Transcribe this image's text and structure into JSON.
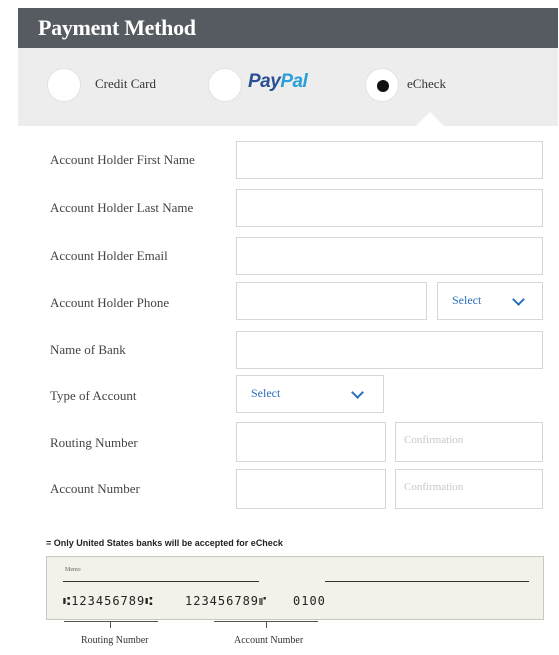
{
  "header": {
    "title": "Payment Method"
  },
  "payment_options": [
    {
      "label": "Credit Card",
      "selected": false
    },
    {
      "label_parts": [
        "Pay",
        "Pal"
      ],
      "selected": false
    },
    {
      "label": "eCheck",
      "selected": true
    }
  ],
  "form": {
    "first_name": {
      "label": "Account Holder First Name",
      "value": ""
    },
    "last_name": {
      "label": "Account Holder Last Name",
      "value": ""
    },
    "email": {
      "label": "Account Holder Email",
      "value": ""
    },
    "phone": {
      "label": "Account Holder Phone",
      "value": "",
      "type_select": "Select"
    },
    "bank_name": {
      "label": "Name of Bank",
      "value": ""
    },
    "account_type": {
      "label": "Type of Account",
      "select": "Select"
    },
    "routing": {
      "label": "Routing Number",
      "value": "",
      "confirm_placeholder": "Confirmation"
    },
    "account": {
      "label": "Account Number",
      "value": "",
      "confirm_placeholder": "Confirmation"
    }
  },
  "note": "= Only United States banks will be accepted for eCheck",
  "check_image": {
    "memo": "Memo",
    "micr_routing": "⑆123456789⑆",
    "micr_account": "123456789⑈",
    "micr_check": "0100",
    "legend_routing": "Routing Number",
    "legend_account": "Account Number"
  },
  "colors": {
    "header_bg": "#565b62",
    "tab_bg": "#ededed",
    "link_blue": "#2a6fbf",
    "paypal_dark": "#2a4f95",
    "paypal_light": "#2a9fd9"
  }
}
